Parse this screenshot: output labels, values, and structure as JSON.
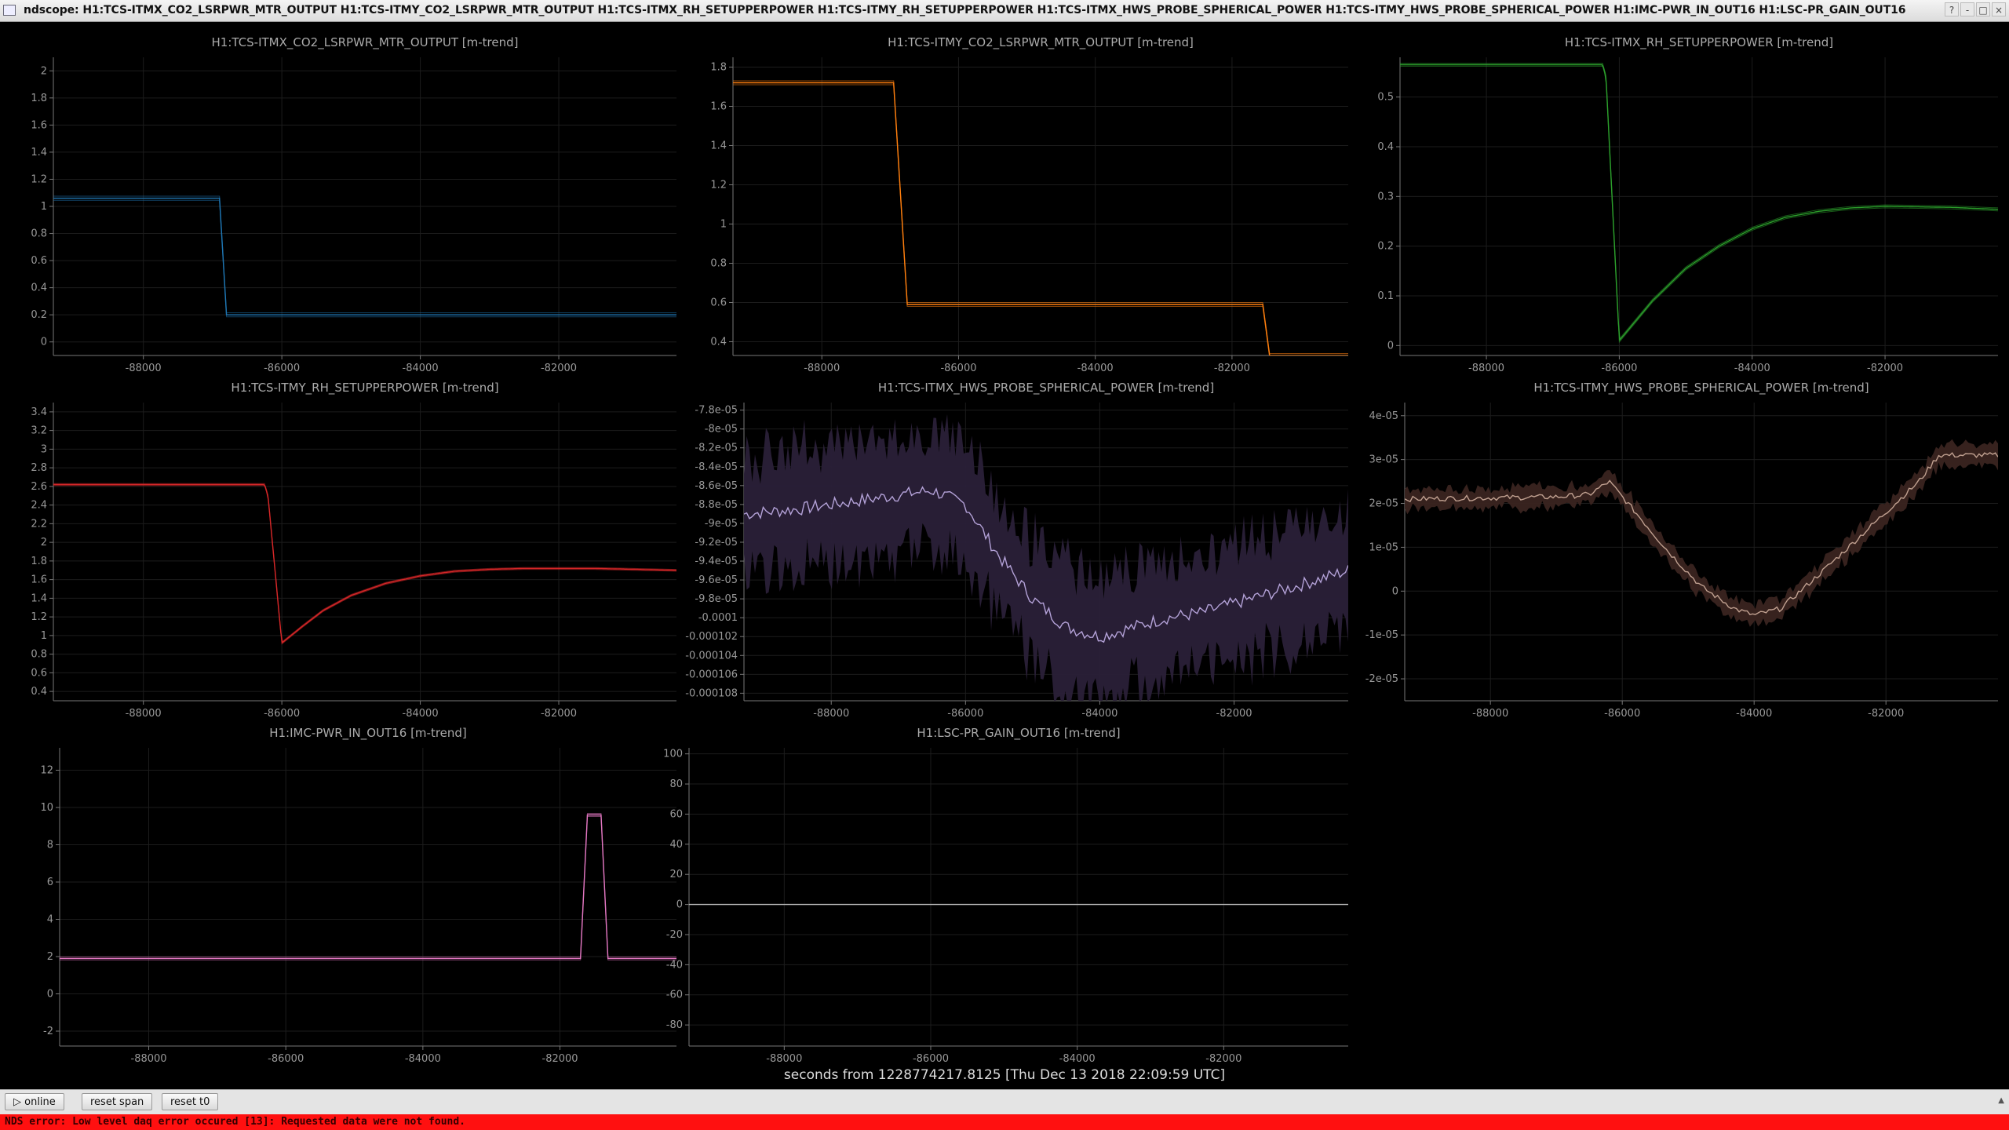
{
  "window": {
    "title": "ndscope: H1:TCS-ITMX_CO2_LSRPWR_MTR_OUTPUT H1:TCS-ITMY_CO2_LSRPWR_MTR_OUTPUT H1:TCS-ITMX_RH_SETUPPERPOWER H1:TCS-ITMY_RH_SETUPPERPOWER H1:TCS-ITMX_HWS_PROBE_SPHERICAL_POWER H1:TCS-ITMY_HWS_PROBE_SPHERICAL_POWER H1:IMC-PWR_IN_OUT16 H1:LSC-PR_GAIN_OUT16",
    "buttons": [
      "?",
      "-",
      "□",
      "×"
    ]
  },
  "x_axis_caption": "seconds from 1228774217.8125 [Thu Dec 13 2018 22:09:59 UTC]",
  "controls": {
    "online_label": "▷ online",
    "reset_span_label": "reset span",
    "reset_t0_label": "reset t0"
  },
  "status": {
    "error": "NDS error: Low level daq error occured [13]: Requested data were not found."
  },
  "colors": {
    "background": "#000000",
    "grid": "#1c1c1c",
    "axis": "#777777",
    "error_bar": "#ff1010"
  },
  "chart_data": [
    {
      "type": "line",
      "title": "H1:TCS-ITMX_CO2_LSRPWR_MTR_OUTPUT [m-trend]",
      "color": "#1f77b4",
      "xlim": [
        -89300,
        -80300
      ],
      "ylim": [
        -0.1,
        2.1
      ],
      "yticks": [
        0,
        0.2,
        0.4,
        0.6,
        0.8,
        1,
        1.2,
        1.4,
        1.6,
        1.8,
        2
      ],
      "xticks": [
        -88000,
        -86000,
        -84000,
        -82000
      ],
      "band": 0.015,
      "x": [
        -89300,
        -86900,
        -86800,
        -80300
      ],
      "y": [
        1.06,
        1.06,
        0.2,
        0.2
      ]
    },
    {
      "type": "line",
      "title": "H1:TCS-ITMY_CO2_LSRPWR_MTR_OUTPUT [m-trend]",
      "color": "#ff7f0e",
      "xlim": [
        -89300,
        -80300
      ],
      "ylim": [
        0.33,
        1.85
      ],
      "yticks": [
        0.4,
        0.6,
        0.8,
        1,
        1.2,
        1.4,
        1.6,
        1.8
      ],
      "xticks": [
        -88000,
        -86000,
        -84000,
        -82000
      ],
      "band": 0.01,
      "x": [
        -89300,
        -86950,
        -86750,
        -81550,
        -81450,
        -80300
      ],
      "y": [
        1.72,
        1.72,
        0.59,
        0.59,
        0.33,
        0.33
      ]
    },
    {
      "type": "line",
      "title": "H1:TCS-ITMX_RH_SETUPPERPOWER [m-trend]",
      "color": "#2ca02c",
      "xlim": [
        -89300,
        -80300
      ],
      "ylim": [
        -0.02,
        0.58
      ],
      "yticks": [
        0,
        0.1,
        0.2,
        0.3,
        0.4,
        0.5
      ],
      "xticks": [
        -88000,
        -86000,
        -84000,
        -82000
      ],
      "band": 0.003,
      "x": [
        -89300,
        -86250,
        -86200,
        -86000,
        -85500,
        -85000,
        -84500,
        -84000,
        -83500,
        -83000,
        -82500,
        -82000,
        -81500,
        -81000,
        -80300
      ],
      "y": [
        0.565,
        0.565,
        0.54,
        0.01,
        0.09,
        0.155,
        0.2,
        0.235,
        0.258,
        0.27,
        0.277,
        0.28,
        0.279,
        0.278,
        0.274
      ]
    },
    {
      "type": "line",
      "title": "H1:TCS-ITMY_RH_SETUPPERPOWER [m-trend]",
      "color": "#d62728",
      "xlim": [
        -89300,
        -80300
      ],
      "ylim": [
        0.3,
        3.5
      ],
      "yticks": [
        0.4,
        0.6,
        0.8,
        1,
        1.2,
        1.4,
        1.6,
        1.8,
        2,
        2.2,
        2.4,
        2.6,
        2.8,
        3,
        3.2,
        3.4
      ],
      "xticks": [
        -88000,
        -86000,
        -84000,
        -82000
      ],
      "band": 0.01,
      "x": [
        -89300,
        -86250,
        -86200,
        -86000,
        -85700,
        -85400,
        -85000,
        -84500,
        -84000,
        -83500,
        -83000,
        -82500,
        -82000,
        -81500,
        -80300
      ],
      "y": [
        2.62,
        2.62,
        2.5,
        0.92,
        1.1,
        1.27,
        1.43,
        1.56,
        1.64,
        1.69,
        1.71,
        1.72,
        1.72,
        1.72,
        1.7
      ]
    },
    {
      "type": "line",
      "title": "H1:TCS-ITMX_HWS_PROBE_SPHERICAL_POWER [m-trend]",
      "color": "#b4a2d8",
      "band_color": "#2a2038",
      "xlim": [
        -89300,
        -80300
      ],
      "ylim": [
        -0.0001088,
        -7.72e-05
      ],
      "yticks": [
        -7.8e-05,
        -8e-05,
        -8.2e-05,
        -8.4e-05,
        -8.6e-05,
        -8.8e-05,
        -9e-05,
        -9.2e-05,
        -9.4e-05,
        -9.6e-05,
        -9.8e-05,
        -0.0001,
        -0.000102,
        -0.000104,
        -0.000106,
        -0.000108
      ],
      "ytick_labels": [
        "-7.8e-05",
        "-8e-05",
        "-8.2e-05",
        "-8.4e-05",
        "-8.6e-05",
        "-8.8e-05",
        "-9e-05",
        "-9.2e-05",
        "-9.4e-05",
        "-9.6e-05",
        "-9.8e-05",
        "-0.0001",
        "-0.000102",
        "-0.000104",
        "-0.000106",
        "-0.000108"
      ],
      "xticks": [
        -88000,
        -86000,
        -84000,
        -82000
      ],
      "band": 7e-06,
      "noise": 7e-07,
      "x": [
        -89300,
        -88500,
        -87500,
        -86500,
        -86000,
        -85500,
        -85000,
        -84500,
        -84000,
        -83500,
        -83000,
        -82500,
        -82000,
        -81500,
        -81000,
        -80300
      ],
      "y": [
        -8.9e-05,
        -8.85e-05,
        -8.75e-05,
        -8.65e-05,
        -8.8e-05,
        -9.35e-05,
        -9.8e-05,
        -0.000101,
        -0.000102,
        -0.000101,
        -0.0001,
        -9.95e-05,
        -9.85e-05,
        -9.75e-05,
        -9.65e-05,
        -9.5e-05
      ]
    },
    {
      "type": "line",
      "title": "H1:TCS-ITMY_HWS_PROBE_SPHERICAL_POWER [m-trend]",
      "color": "#c0a090",
      "band_color": "#3a2420",
      "xlim": [
        -89300,
        -80300
      ],
      "ylim": [
        -2.5e-05,
        4.3e-05
      ],
      "yticks": [
        -2e-05,
        -1e-05,
        0,
        1e-05,
        2e-05,
        3e-05,
        4e-05
      ],
      "ytick_labels": [
        "-2e-05",
        "-1e-05",
        "0",
        "1e-05",
        "2e-05",
        "3e-05",
        "4e-05"
      ],
      "xticks": [
        -88000,
        -86000,
        -84000,
        -82000
      ],
      "band": 2.5e-06,
      "noise": 6e-07,
      "x": [
        -89300,
        -87000,
        -86500,
        -86200,
        -85800,
        -85300,
        -84800,
        -84300,
        -84000,
        -83600,
        -83000,
        -82500,
        -82000,
        -81500,
        -81200,
        -80300
      ],
      "y": [
        2.1e-05,
        2.15e-05,
        2.2e-05,
        2.5e-05,
        1.8e-05,
        9e-06,
        1e-06,
        -4e-06,
        -5.5e-06,
        -4e-06,
        4e-06,
        1.1e-05,
        1.8e-05,
        2.5e-05,
        3.1e-05,
        3.1e-05
      ]
    },
    {
      "type": "line",
      "title": "H1:IMC-PWR_IN_OUT16 [m-trend]",
      "color": "#e377c2",
      "xlim": [
        -89300,
        -80300
      ],
      "ylim": [
        -2.8,
        13.2
      ],
      "yticks": [
        -2,
        0,
        2,
        4,
        6,
        8,
        10,
        12
      ],
      "xticks": [
        -88000,
        -86000,
        -84000,
        -82000
      ],
      "band": 0.08,
      "x": [
        -89300,
        -81700,
        -81600,
        -81400,
        -81300,
        -80300
      ],
      "y": [
        1.9,
        1.9,
        9.6,
        9.6,
        1.9,
        1.9
      ]
    },
    {
      "type": "line",
      "title": "H1:LSC-PR_GAIN_OUT16 [m-trend]",
      "color": "#bbbbbb",
      "xlim": [
        -89300,
        -80300
      ],
      "ylim": [
        -94,
        104
      ],
      "yticks": [
        -80,
        -60,
        -40,
        -20,
        0,
        20,
        40,
        60,
        80,
        100
      ],
      "xticks": [
        -88000,
        -86000,
        -84000,
        -82000
      ],
      "band": 0,
      "x": [
        -89300,
        -80300
      ],
      "y": [
        0,
        0
      ]
    }
  ]
}
